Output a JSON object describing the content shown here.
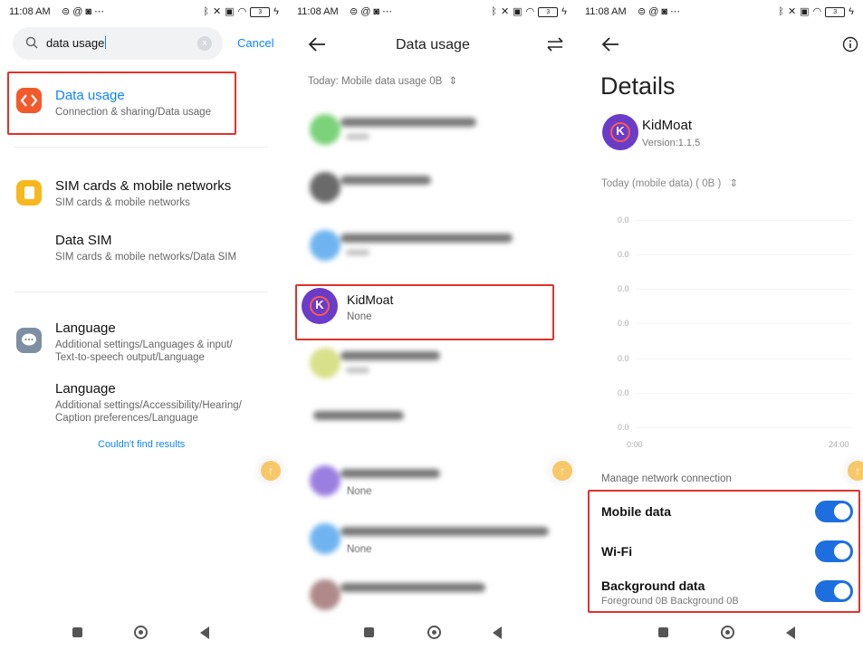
{
  "colors": {
    "accent": "#0d84ff",
    "highlight": "#e0322c",
    "toggle_on": "#1d6fe0",
    "kidmoat": "#6a3cc8"
  },
  "status_bar": {
    "time": "11:08 AM",
    "battery": "3"
  },
  "search_screen": {
    "query": "data usage",
    "cancel_label": "Cancel",
    "results": [
      {
        "title": "Data usage",
        "subtitle": "Connection & sharing/Data usage",
        "icon": "data-usage-icon"
      },
      {
        "title": "SIM cards & mobile networks",
        "subtitle": "SIM cards & mobile networks",
        "icon": "sim-card-icon"
      },
      {
        "title": "Data SIM",
        "subtitle": "SIM cards & mobile networks/Data SIM"
      },
      {
        "title": "Language",
        "subtitle": "Additional settings/Languages & input/",
        "subtitle2": "Text-to-speech output/Language",
        "icon": "language-icon"
      },
      {
        "title": "Language",
        "subtitle": "Additional settings/Accessibility/Hearing/",
        "subtitle2": "Caption preferences/Language"
      }
    ],
    "not_found": "Couldn't find results"
  },
  "data_usage_screen": {
    "title": "Data usage",
    "filter": "Today: Mobile data usage 0B",
    "highlighted_app": {
      "name": "KidMoat",
      "usage": "None"
    },
    "blurred_subtitle": "None"
  },
  "details_screen": {
    "title": "Details",
    "app_name": "KidMoat",
    "version": "Version:1.1.5",
    "period": "Today (mobile data) ( 0B )",
    "y_ticks": [
      "0.0",
      "0.0",
      "0.0",
      "0.0",
      "0.0",
      "0.0",
      "0.0"
    ],
    "x_ticks": [
      "0:00",
      "24:00"
    ],
    "section_label": "Manage network connection",
    "toggles": [
      {
        "label": "Mobile data",
        "on": true
      },
      {
        "label": "Wi-Fi",
        "on": true
      },
      {
        "label": "Background data",
        "sub": "Foreground 0B  Background 0B",
        "on": true
      }
    ]
  }
}
